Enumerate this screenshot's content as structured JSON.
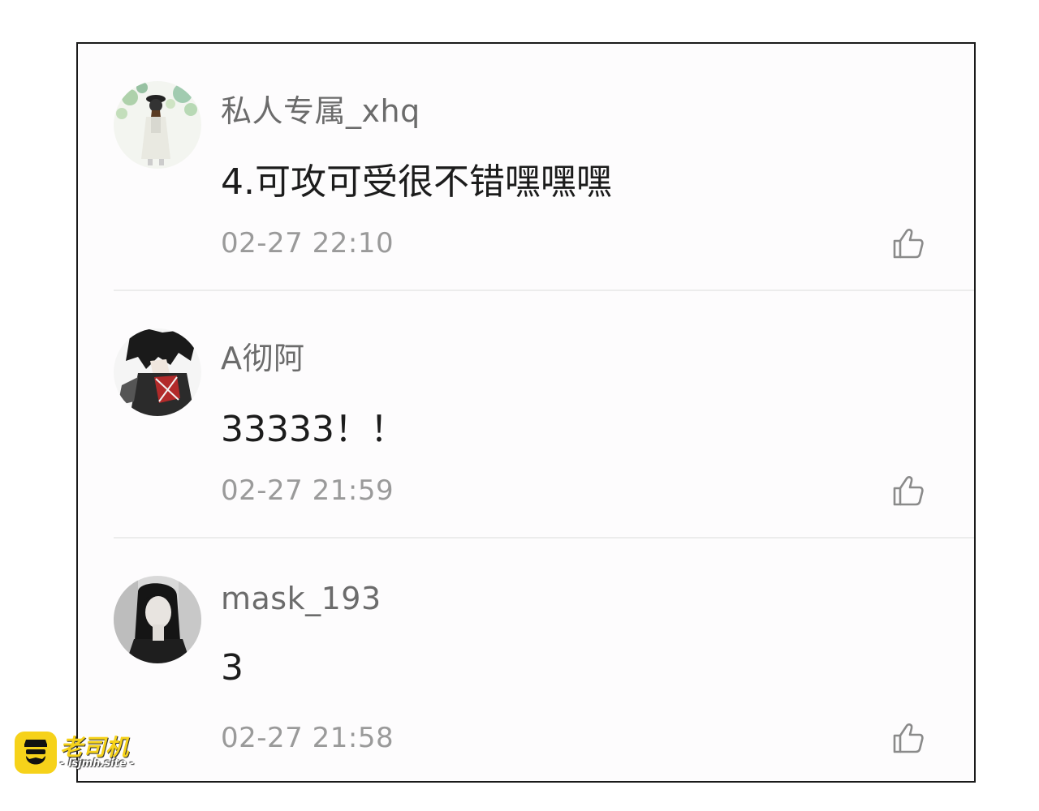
{
  "comments": [
    {
      "username": "私人专属_xhq",
      "content": "4.可攻可受很不错嘿嘿嘿",
      "time": "02-27 22:10",
      "avatar": "avatar-girl-green-icon"
    },
    {
      "username": "A彻阿",
      "content": "33333！！",
      "time": "02-27 21:59",
      "avatar": "avatar-anime-boy-icon"
    },
    {
      "username": "mask_193",
      "content": "3",
      "time": "02-27 21:58",
      "avatar": "avatar-bw-girl-icon"
    }
  ],
  "like_icon": "thumbs-up-icon",
  "watermark": {
    "title": "老司机",
    "url": "- lsjmh.site -"
  },
  "colors": {
    "username": "#6b6b6b",
    "content": "#1c1c1c",
    "time": "#9a9a9a",
    "divider": "#ececec",
    "watermark_accent": "#f6d21a"
  }
}
